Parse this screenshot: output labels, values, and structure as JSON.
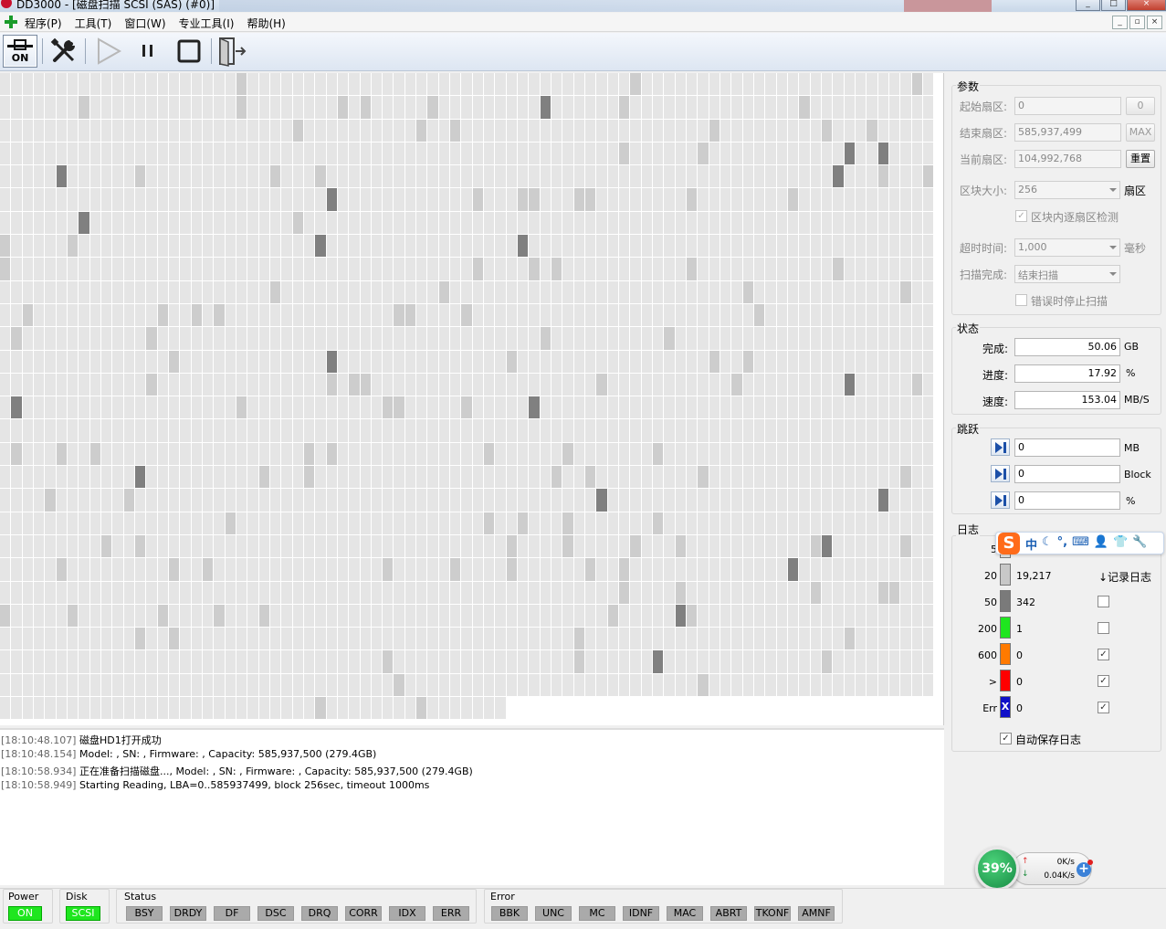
{
  "window": {
    "title": "DD3000 - [磁盘扫描 SCSI (SAS) (#0)]",
    "controls": [
      "_",
      "□",
      "×"
    ]
  },
  "menu": [
    "程序(P)",
    "工具(T)",
    "窗口(W)",
    "专业工具(I)",
    "帮助(H)"
  ],
  "mdi_controls": [
    "_",
    "▫",
    "×"
  ],
  "toolbar": {
    "power_label": "ON",
    "buttons": [
      "power-on",
      "tools",
      "play",
      "pause",
      "stop",
      "exit"
    ]
  },
  "colors": {
    "block_light": "#e5e5e5",
    "block_mid": "#cdcdcd",
    "block_dark": "#808080",
    "indicator_on": "#1fe61f",
    "legend_20": "#c8c8c8",
    "legend_50": "#7a7a7a",
    "legend_200": "#1fe61f",
    "legend_600": "#ff7a00",
    "legend_gt": "#ff0000",
    "legend_err": "#1010c8"
  },
  "log": [
    {
      "time": "[18:10:48.107]",
      "text": "磁盘HD1打开成功"
    },
    {
      "time": "[18:10:48.154]",
      "text": "Model: , SN: , Firmware: , Capacity: 585,937,500 (279.4GB)"
    },
    {
      "time": "[18:10:58.934]",
      "text": "正在准备扫描磁盘..., Model: , SN: , Firmware: , Capacity: 585,937,500 (279.4GB)"
    },
    {
      "time": "[18:10:58.949]",
      "text": "Starting Reading, LBA=0..585937499, block 256sec, timeout 1000ms"
    }
  ],
  "params": {
    "title": "参数",
    "start_label": "起始扇区:",
    "start_value": "0",
    "start_btn": "0",
    "end_label": "结束扇区:",
    "end_value": "585,937,499",
    "end_btn": "MAX",
    "current_label": "当前扇区:",
    "current_value": "104,992,768",
    "reset_btn": "重置",
    "block_label": "区块大小:",
    "block_value": "256",
    "block_unit": "扇区",
    "check_in_block": "区块内逐扇区检测",
    "timeout_label": "超时时间:",
    "timeout_value": "1,000",
    "timeout_unit": "毫秒",
    "finish_label": "扫描完成:",
    "finish_value": "结束扫描",
    "stop_on_error": "错误时停止扫描"
  },
  "state": {
    "title": "状态",
    "done_label": "完成:",
    "done_value": "50.06",
    "done_unit": "GB",
    "progress_label": "进度:",
    "progress_value": "17.92",
    "progress_unit": "%",
    "speed_label": "速度:",
    "speed_value": "153.04",
    "speed_unit": "MB/S"
  },
  "jump": {
    "title": "跳跃",
    "mb_value": "0",
    "mb_unit": "MB",
    "block_value": "0",
    "block_unit": "Block",
    "pct_value": "0",
    "pct_unit": "%"
  },
  "logpanel": {
    "title": "日志",
    "rows": [
      {
        "label": "5",
        "count": ""
      },
      {
        "label": "20",
        "count": "19,217"
      },
      {
        "label": "50",
        "count": "342"
      },
      {
        "label": "200",
        "count": "1"
      },
      {
        "label": "600",
        "count": "0"
      },
      {
        "label": ">",
        "count": "0"
      },
      {
        "label": "Err",
        "count": "0",
        "mark": "X"
      }
    ],
    "record_label": "↓记录日志",
    "autosave": "自动保存日志"
  },
  "ime": {
    "logo": "S",
    "icons": [
      "中",
      "☾",
      "°,",
      "⌨",
      "👤",
      "👕",
      "🔧"
    ]
  },
  "net": {
    "percent": "39%",
    "up": "0K/s",
    "down": "0.04K/s"
  },
  "status": {
    "power_title": "Power",
    "power_value": "ON",
    "disk_title": "Disk",
    "disk_value": "SCSI",
    "status_title": "Status",
    "status_items": [
      "BSY",
      "DRDY",
      "DF",
      "DSC",
      "DRQ",
      "CORR",
      "IDX",
      "ERR"
    ],
    "error_title": "Error",
    "error_items": [
      "BBK",
      "UNC",
      "MC",
      "IDNF",
      "MAC",
      "ABRT",
      "TKONF",
      "AMNF"
    ]
  }
}
